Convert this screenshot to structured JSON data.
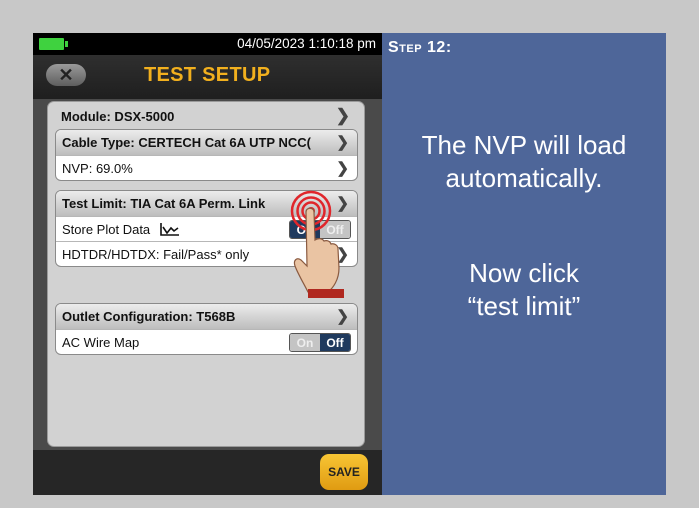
{
  "device": {
    "datetime": "04/05/2023 1:10:18 pm",
    "title": "TEST SETUP",
    "back_icon": "x-close-icon",
    "module": "Module: DSX-5000",
    "cable_type": "Cable Type: CERTECH Cat 6A UTP NCC(",
    "nvp": "NVP: 69.0%",
    "test_limit": "Test Limit: TIA Cat 6A Perm. Link",
    "store_plot": {
      "label": "Store Plot Data",
      "toggle_on": "On",
      "toggle_off": "Off",
      "state": "On"
    },
    "hdtdr": "HDTDR/HDTDX: Fail/Pass* only",
    "outlet": "Outlet Configuration: T568B",
    "ac_wire_map": {
      "label": "AC Wire Map",
      "toggle_on": "On",
      "toggle_off": "Off",
      "state": "Off"
    },
    "save_label": "SAVE",
    "colors": {
      "title": "#f2b01e",
      "toggle_active": "#1f3a5e",
      "save": "#f2b01e",
      "battery": "#3fd23f"
    }
  },
  "instruction": {
    "step_word": "Step",
    "step_number": "12:",
    "line1": "The NVP will load automatically.",
    "line2": "Now click “test limit”",
    "background": "#4e6699"
  }
}
